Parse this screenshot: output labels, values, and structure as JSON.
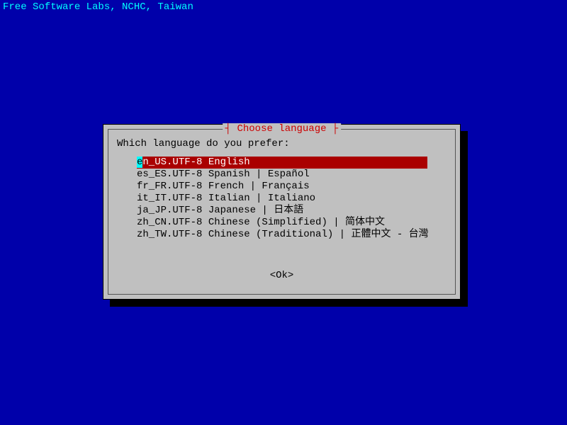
{
  "header": {
    "org": "Free Software Labs, NCHC, Taiwan"
  },
  "dialog": {
    "title_decorated": "┤ Choose language ├",
    "prompt": "Which language do you prefer:",
    "selected_index": 0,
    "items": [
      {
        "label": "en_US.UTF-8 English"
      },
      {
        "label": "es_ES.UTF-8 Spanish | Español"
      },
      {
        "label": "fr_FR.UTF-8 French | Français"
      },
      {
        "label": "it_IT.UTF-8 Italian | Italiano"
      },
      {
        "label": "ja_JP.UTF-8 Japanese | 日本語"
      },
      {
        "label": "zh_CN.UTF-8 Chinese (Simplified) | 简体中文"
      },
      {
        "label": "zh_TW.UTF-8 Chinese (Traditional) | 正體中文 - 台灣"
      }
    ],
    "ok_label": "<Ok>"
  },
  "colors": {
    "background": "#0000aa",
    "panel": "#c0c0c0",
    "title": "#cc0000",
    "highlight_bg": "#aa0000",
    "highlight_fg": "#ffffff",
    "cursor": "#00ffff"
  }
}
